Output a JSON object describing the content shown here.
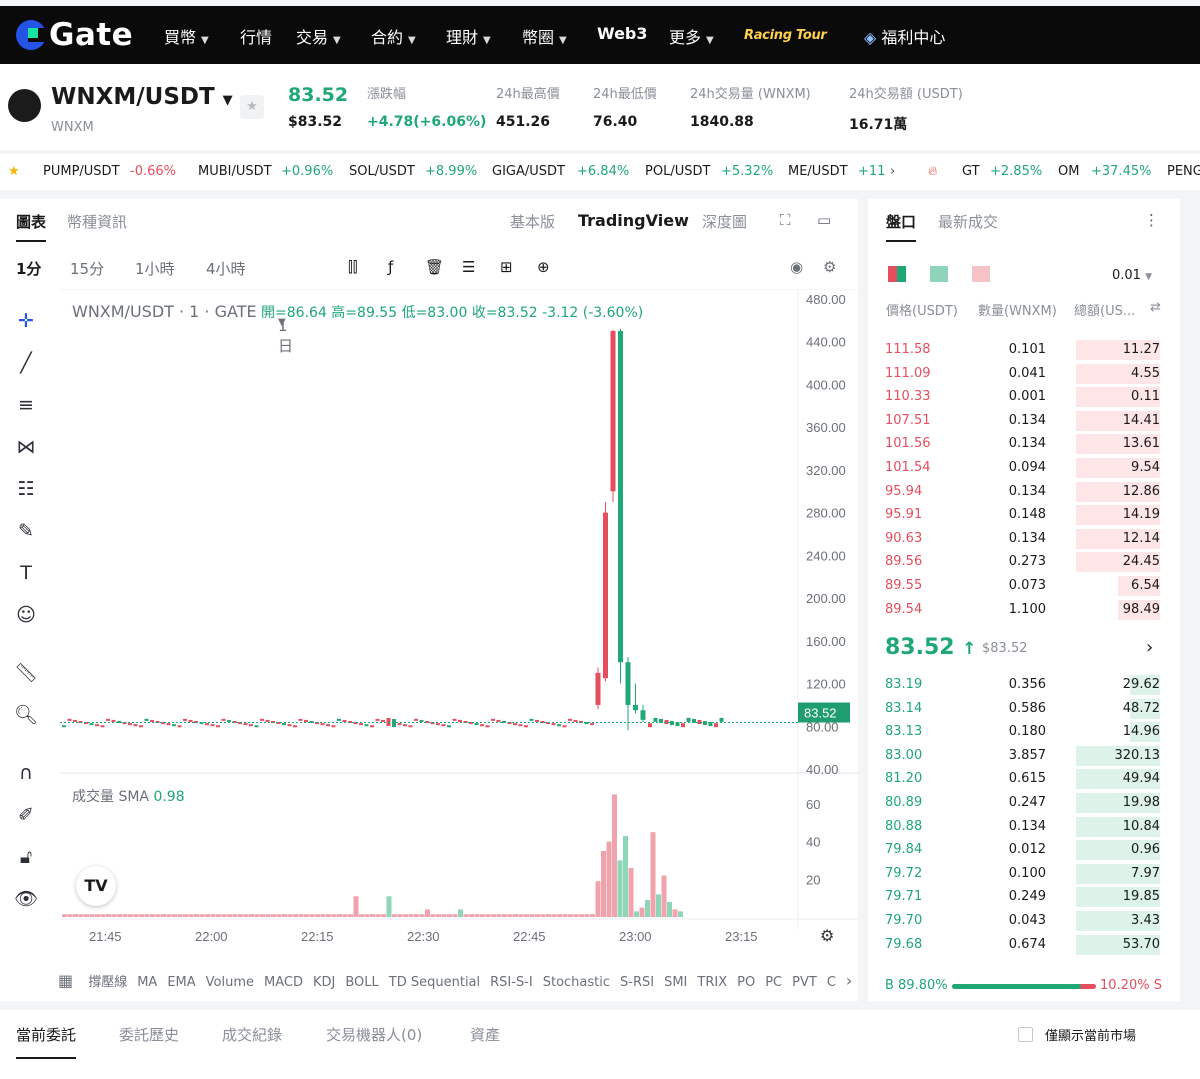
{
  "nav": {
    "logo": "Gate",
    "items": [
      {
        "label": "買幣",
        "dropdown": true
      },
      {
        "label": "行情",
        "dropdown": false
      },
      {
        "label": "交易",
        "dropdown": true
      },
      {
        "label": "合約",
        "dropdown": true
      },
      {
        "label": "理財",
        "dropdown": true
      },
      {
        "label": "幣圈",
        "dropdown": true
      },
      {
        "label": "Web3",
        "dropdown": false
      },
      {
        "label": "更多",
        "dropdown": true
      }
    ],
    "racing": "Racing Tour",
    "welfare": "福利中心"
  },
  "pair": {
    "name": "WNXM/USDT",
    "sub": "WNXM",
    "price": "83.52",
    "price_usd": "$83.52",
    "stats": [
      {
        "label": "漲跌幅",
        "value": "+4.78(+6.06%)"
      },
      {
        "label": "24h最高價",
        "value": "451.26"
      },
      {
        "label": "24h最低價",
        "value": "76.40"
      },
      {
        "label": "24h交易量 (WNXM)",
        "value": "1840.88"
      },
      {
        "label": "24h交易額 (USDT)",
        "value": "16.71萬"
      }
    ]
  },
  "ticker": [
    {
      "sym": "PUMP/USDT",
      "chg": "-0.66%",
      "up": false
    },
    {
      "sym": "MUBI/USDT",
      "chg": "+0.96%",
      "up": true
    },
    {
      "sym": "SOL/USDT",
      "chg": "+8.99%",
      "up": true
    },
    {
      "sym": "GIGA/USDT",
      "chg": "+6.84%",
      "up": true
    },
    {
      "sym": "POL/USDT",
      "chg": "+5.32%",
      "up": true
    },
    {
      "sym": "ME/USDT",
      "chg": "+11",
      "up": true
    },
    {
      "sym": "GT",
      "chg": "+2.85%",
      "up": true
    },
    {
      "sym": "OM",
      "chg": "+37.45%",
      "up": true
    },
    {
      "sym": "PENG",
      "chg": "",
      "up": true
    }
  ],
  "chart": {
    "tabs_left": [
      "圖表",
      "幣種資訊"
    ],
    "tabs_right": [
      "基本版",
      "TradingView",
      "深度圖"
    ],
    "timeframes": [
      "1分",
      "15分",
      "1小時",
      "4小時",
      "1日"
    ],
    "legend_pair": "WNXM/USDT · 1 · GATE",
    "legend_ohlc": "開=86.64 高=89.55 低=83.00 收=83.52 -3.12 (-3.60%)",
    "last_price_tag": "83.52",
    "volume_label": "成交量 SMA",
    "volume_value": "0.98",
    "indicators": [
      "撐壓線",
      "MA",
      "EMA",
      "Volume",
      "MACD",
      "KDJ",
      "BOLL",
      "TD Sequential",
      "RSI-S-I",
      "Stochastic",
      "S-RSI",
      "SMI",
      "TRIX",
      "PO",
      "PC",
      "PVT",
      "C"
    ]
  },
  "chart_data": {
    "type": "candlestick",
    "title": "WNXM/USDT · 1 · GATE",
    "price_ticks": [
      "480.00",
      "440.00",
      "400.00",
      "360.00",
      "320.00",
      "280.00",
      "240.00",
      "200.00",
      "160.00",
      "120.00",
      "80.00",
      "40.00"
    ],
    "ylim": [
      40,
      480
    ],
    "volume_ticks": [
      "60",
      "40",
      "20"
    ],
    "x_ticks": [
      "21:45",
      "22:00",
      "22:15",
      "22:30",
      "22:45",
      "23:00",
      "23:15"
    ],
    "spike_candles": [
      {
        "o": 100,
        "c": 130,
        "h": 135,
        "l": 96,
        "up": false
      },
      {
        "o": 125,
        "c": 280,
        "h": 290,
        "l": 122,
        "up": false
      },
      {
        "o": 300,
        "c": 450,
        "h": 451.26,
        "l": 290,
        "up": false
      },
      {
        "o": 450,
        "c": 140,
        "h": 452,
        "l": 120,
        "up": true
      },
      {
        "o": 140,
        "c": 100,
        "h": 145,
        "l": 76.4,
        "up": true
      },
      {
        "o": 100,
        "c": 95,
        "h": 120,
        "l": 92,
        "up": true
      },
      {
        "o": 95,
        "c": 86,
        "h": 100,
        "l": 84,
        "up": true
      }
    ],
    "volumes": [
      0,
      0,
      0,
      0,
      0,
      0,
      0,
      0,
      0,
      0,
      0,
      0,
      0,
      0,
      0,
      0,
      0,
      0,
      0,
      0,
      0,
      0,
      0,
      0,
      0,
      0,
      0,
      0,
      0,
      0,
      0,
      0,
      0,
      0,
      0,
      0,
      0,
      0,
      0,
      0,
      0,
      0,
      0,
      0,
      0,
      0,
      0,
      0,
      0,
      0,
      0,
      0,
      0,
      0,
      0,
      0,
      0,
      0,
      0,
      0,
      0,
      0,
      0,
      0,
      0,
      0,
      0,
      0,
      0,
      0,
      0,
      0,
      0,
      0,
      0,
      0,
      0,
      0,
      0,
      0,
      0,
      0,
      0,
      0,
      0,
      0,
      0,
      0,
      0,
      0,
      0,
      0,
      0,
      0,
      0,
      0,
      0,
      0,
      0,
      0,
      0,
      0,
      0,
      0,
      0,
      0,
      0,
      0,
      0,
      0,
      0,
      0,
      0,
      0,
      0,
      0
    ]
  },
  "orderbook": {
    "tabs": [
      "盤口",
      "最新成交"
    ],
    "precision": "0.01",
    "headers": [
      "價格(USDT)",
      "數量(WNXM)",
      "總額(US..."
    ],
    "asks": [
      {
        "p": "111.58",
        "a": "0.101",
        "t": "11.27",
        "w": 0.28
      },
      {
        "p": "111.09",
        "a": "0.041",
        "t": "4.55",
        "w": 0.28
      },
      {
        "p": "110.33",
        "a": "0.001",
        "t": "0.11",
        "w": 0.28
      },
      {
        "p": "107.51",
        "a": "0.134",
        "t": "14.41",
        "w": 0.28
      },
      {
        "p": "101.56",
        "a": "0.134",
        "t": "13.61",
        "w": 0.28
      },
      {
        "p": "101.54",
        "a": "0.094",
        "t": "9.54",
        "w": 0.28
      },
      {
        "p": "95.94",
        "a": "0.134",
        "t": "12.86",
        "w": 0.28
      },
      {
        "p": "95.91",
        "a": "0.148",
        "t": "14.19",
        "w": 0.28
      },
      {
        "p": "90.63",
        "a": "0.134",
        "t": "12.14",
        "w": 0.28
      },
      {
        "p": "89.56",
        "a": "0.273",
        "t": "24.45",
        "w": 0.28
      },
      {
        "p": "89.55",
        "a": "0.073",
        "t": "6.54",
        "w": 0.14
      },
      {
        "p": "89.54",
        "a": "1.100",
        "t": "98.49",
        "w": 0.14
      }
    ],
    "mid_price": "83.52",
    "mid_usd": "$83.52",
    "bids": [
      {
        "p": "83.19",
        "a": "0.356",
        "t": "29.62",
        "w": 0.1
      },
      {
        "p": "83.14",
        "a": "0.586",
        "t": "48.72",
        "w": 0.1
      },
      {
        "p": "83.13",
        "a": "0.180",
        "t": "14.96",
        "w": 0.1
      },
      {
        "p": "83.00",
        "a": "3.857",
        "t": "320.13",
        "w": 0.28
      },
      {
        "p": "81.20",
        "a": "0.615",
        "t": "49.94",
        "w": 0.28
      },
      {
        "p": "80.89",
        "a": "0.247",
        "t": "19.98",
        "w": 0.28
      },
      {
        "p": "80.88",
        "a": "0.134",
        "t": "10.84",
        "w": 0.28
      },
      {
        "p": "79.84",
        "a": "0.012",
        "t": "0.96",
        "w": 0.28
      },
      {
        "p": "79.72",
        "a": "0.100",
        "t": "7.97",
        "w": 0.28
      },
      {
        "p": "79.71",
        "a": "0.249",
        "t": "19.85",
        "w": 0.28
      },
      {
        "p": "79.70",
        "a": "0.043",
        "t": "3.43",
        "w": 0.28
      },
      {
        "p": "79.68",
        "a": "0.674",
        "t": "53.70",
        "w": 0.28
      }
    ],
    "buy_ratio": "B 89.80%",
    "sell_ratio": "10.20% S",
    "buy_fraction": 0.898
  },
  "bottom": {
    "tabs": [
      "當前委託",
      "委託歷史",
      "成交紀錄",
      "交易機器人(0)",
      "資產"
    ],
    "only_current": "僅顯示當前市場"
  },
  "colors": {
    "up": "#1fa876",
    "down": "#e54e5e",
    "accent": "#2354e6"
  }
}
